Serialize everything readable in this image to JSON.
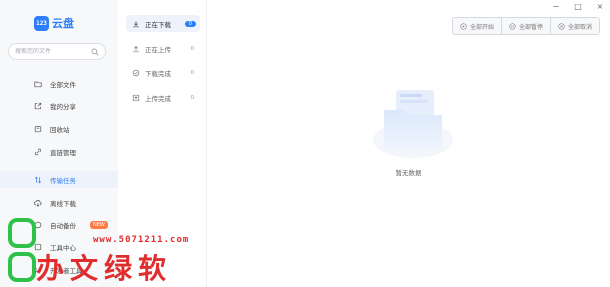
{
  "app": {
    "logo_badge": "123",
    "logo_text": "云盘"
  },
  "search": {
    "placeholder": "搜索您的文件"
  },
  "sidebar": {
    "items": [
      {
        "label": "全部文件",
        "icon": "folder-icon"
      },
      {
        "label": "我的分享",
        "icon": "share-icon"
      },
      {
        "label": "回收站",
        "icon": "trash-icon"
      },
      {
        "label": "直链管理",
        "icon": "link-icon"
      },
      {
        "label": "传输任务",
        "icon": "transfer-icon",
        "active": true
      },
      {
        "label": "离线下载",
        "icon": "cloud-download-icon"
      },
      {
        "label": "自动备份",
        "icon": "backup-icon",
        "badge": "NEW"
      },
      {
        "label": "工具中心",
        "icon": "tools-icon"
      },
      {
        "label": "开发者工具",
        "icon": "developer-icon"
      }
    ]
  },
  "transfer": {
    "items": [
      {
        "label": "正在下载",
        "count": "0",
        "active": true
      },
      {
        "label": "正在上传",
        "count": "0"
      },
      {
        "label": "下载完成",
        "count": "0"
      },
      {
        "label": "上传完成",
        "count": "0"
      }
    ]
  },
  "toolbar": {
    "start_all": "全部开始",
    "pause_all": "全部暂停",
    "cancel_all": "全部取消"
  },
  "window": {
    "minimize": "−",
    "maximize": "□",
    "close": "×"
  },
  "main": {
    "empty_text": "暂无数据"
  },
  "watermark": {
    "url": "www.5071211.com",
    "text": "办文绿软"
  },
  "colors": {
    "accent": "#2d7ff9",
    "sidebar_bg": "#f7f8fa",
    "badge_new": "#ff7a45",
    "watermark_red": "#e02d2d",
    "watermark_green": "#2ec24a"
  }
}
